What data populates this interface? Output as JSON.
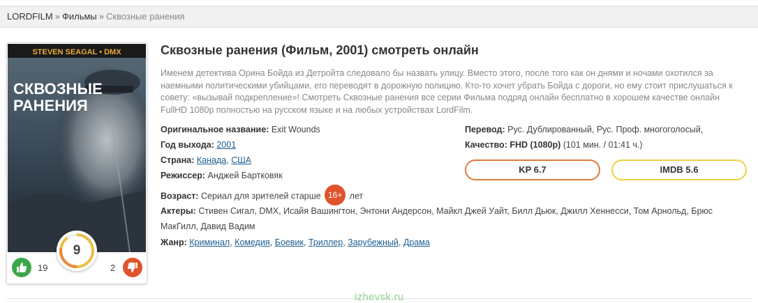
{
  "breadcrumb": {
    "home": "LORDFILM",
    "separator": "»",
    "section": "Фильмы",
    "current": "Сквозные ранения"
  },
  "poster": {
    "top_text": "STEVEN SEAGAL • DMX",
    "title_line1": "СКВОЗНЫЕ",
    "title_line2": "РАНЕНИЯ"
  },
  "votes": {
    "likes": "19",
    "dislikes": "2",
    "rating": "9"
  },
  "movie": {
    "title": "Сквозные ранения (Фильм, 2001) смотреть онлайн",
    "description": "Именем детектива Орина Бойда из Детройта следовало бы назвать улицу. Вместо этого, после того как он днями и ночами охотился за наемными политическими убийцами, его переводят в дорожную полицию. Кто-то хочет убрать Бойда с дороги, но ему стоит прислушаться к совету: «вызывай подкрепление»! Смотреть Сквозные ранения все серии Фильма подряд онлайн бесплатно в хорошем качестве онлайн FullHD 1080p полностью на русском языке и на любых устройствах LordFilm."
  },
  "info": {
    "original_label": "Оригинальное название:",
    "original_value": "Exit Wounds",
    "year_label": "Год выхода:",
    "year_value": "2001",
    "country_label": "Страна:",
    "countries": [
      "Канада",
      "США"
    ],
    "director_label": "Режиссер:",
    "director_value": "Анджей Бартковяк",
    "age_label": "Возраст:",
    "age_prefix": "Сериал для зрителей старше",
    "age_badge": "16+",
    "age_suffix": "лет",
    "actors_label": "Актеры:",
    "actors_value": "Стивен Сигал, DMX, Исайя Вашингтон, Энтони Андерсон, Майкл Джей Уайт, Билл Дьюк, Джилл Хеннесси, Том Арнольд, Брюс МакГилл, Давид Вадим",
    "genre_label": "Жанр:",
    "genres": [
      "Криминал",
      "Комедия",
      "Боевик",
      "Триллер",
      "Зарубежный",
      "Драма"
    ],
    "translation_label": "Перевод:",
    "translation_value": "Рус. Дублированный, Рус. Проф. многоголосый,",
    "quality_label": "Качество:",
    "quality_value": "FHD (1080p)",
    "duration": "(101 мин. / 01:41 ч.)"
  },
  "ratings": {
    "kp": "KP 6.7",
    "imdb": "IMDB 5.6"
  },
  "watermark": "izhevsk.ru",
  "colors": {
    "like": "#3ca648",
    "dislike": "#e0532c",
    "age_badge": "#e0532c",
    "kp_border": "#de7a3a",
    "imdb_border": "#f0cf44",
    "link": "#1c5e92"
  }
}
